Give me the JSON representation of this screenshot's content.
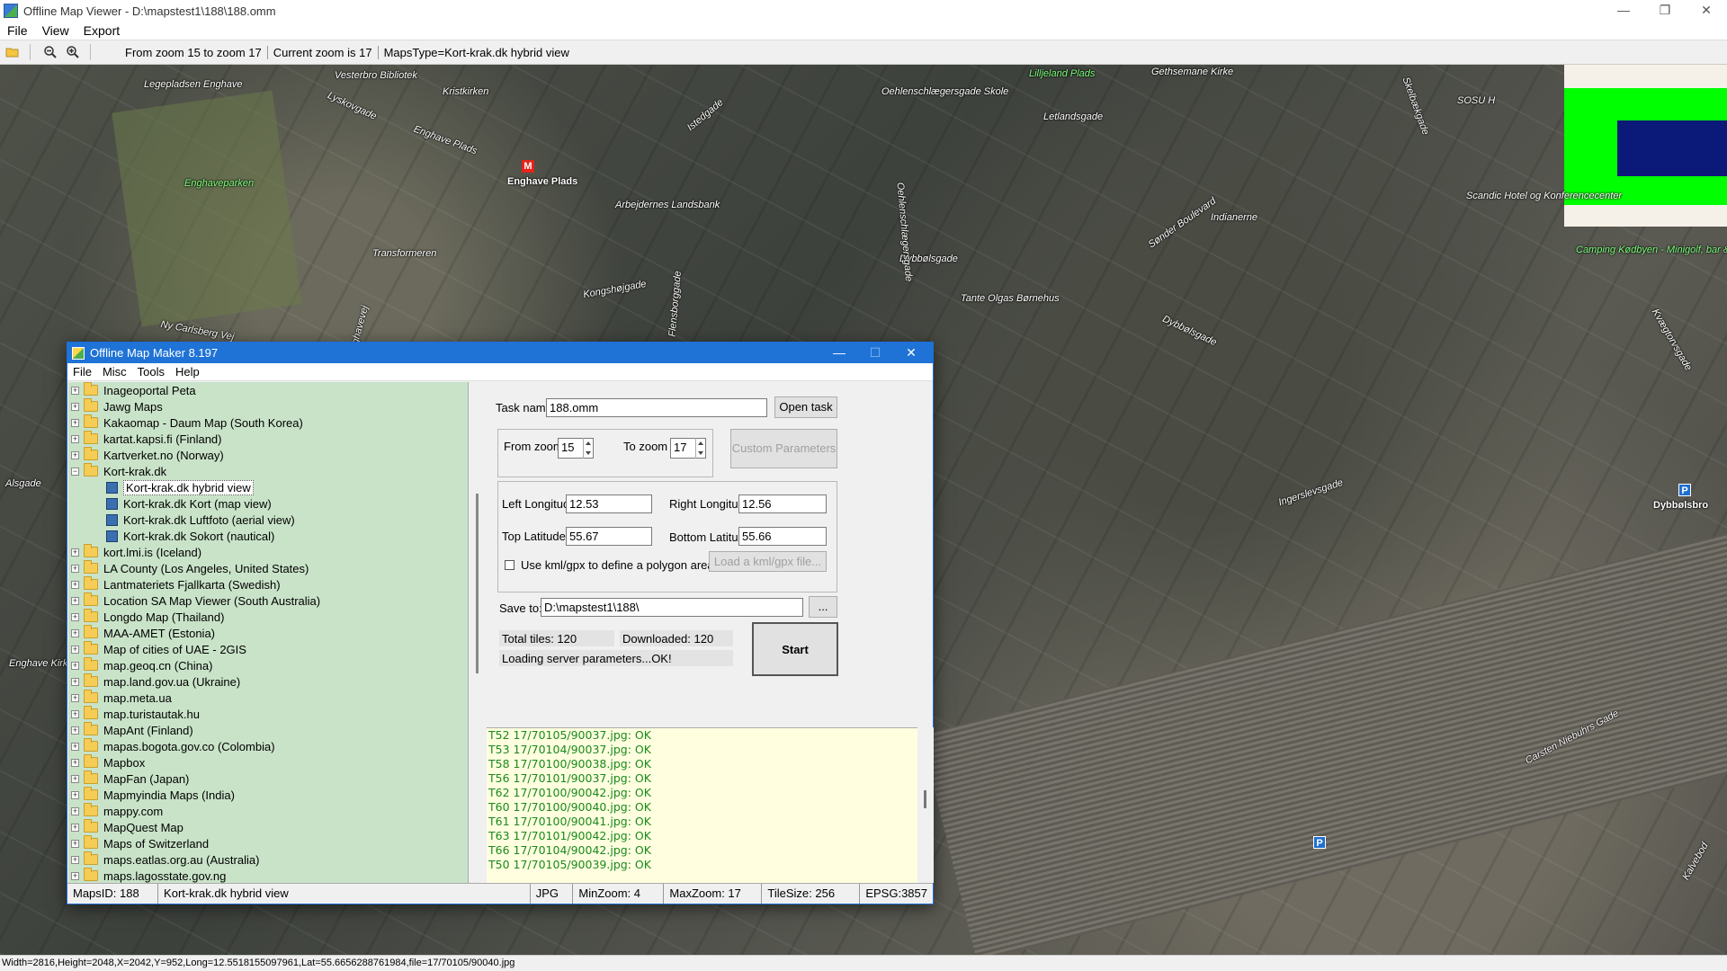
{
  "window": {
    "title": "Offline Map Viewer - D:\\mapstest1\\188\\188.omm",
    "controls": [
      "—",
      "❐",
      "✕"
    ]
  },
  "menu": [
    "File",
    "View",
    "Export"
  ],
  "toolbar": {
    "zoom_range": "From zoom 15 to zoom 17",
    "current_zoom": "Current zoom is 17",
    "maps_type": "MapsType=Kort-krak.dk hybrid view"
  },
  "map_labels": [
    "Vesterbro Bibliotek",
    "Legepladsen Enghave",
    "Lyskovgade",
    "Kristkirken",
    "Enghave Plads",
    "Enghaveparken",
    "Enghave Plads",
    "Istedgade",
    "Oehlenschlægersgade Skole",
    "Lilljeland Plads",
    "Gethsemane Kirke",
    "Letlandsgade",
    "Skelbækgade",
    "SOSU H",
    "Arbejdernes Landsbank",
    "Transformeren",
    "Kongshøjgade",
    "Dybbølsgade",
    "Sønder Boulevard",
    "Indianerne",
    "Tante Olgas Børnehus",
    "Scandic Hotel og Konferencecenter",
    "Camping Kødbyen - Minigolf, bar & burgers",
    "Ny Carlsberg Vej",
    "Enghavevej",
    "Dybbølsgade",
    "Ingerslevsgade",
    "Dybbølsbro",
    "Carsten Niebuhrs Gade",
    "Alsgade",
    "Enghave Kirke",
    "Oehlenschlægersgade",
    "Flensborggade",
    "Kvægtorvsgade",
    "Kalvebod"
  ],
  "map_symbols": {
    "metro": "M",
    "parking": "P"
  },
  "colors": {
    "dialog_title": "#1f73d6",
    "tree_bg": "#c9e3c9",
    "log_bg": "#ffffe0",
    "log_text": "#1a8a1a",
    "minimap_green": "#00ff00",
    "minimap_blue": "#0b1a78"
  },
  "statusline": "Width=2816,Height=2048,X=2042,Y=952,Long=12.5518155097961,Lat=55.6656288761984,file=17/70105/90040.jpg",
  "dialog": {
    "title": "Offline Map Maker 8.197",
    "controls": [
      "—",
      "☐",
      "✕"
    ],
    "menu": [
      "File",
      "Misc",
      "Tools",
      "Help"
    ],
    "tree": [
      {
        "label": "Inageoportal Peta",
        "type": "folder"
      },
      {
        "label": "Jawg Maps",
        "type": "folder"
      },
      {
        "label": "Kakaomap - Daum Map (South Korea)",
        "type": "folder"
      },
      {
        "label": "kartat.kapsi.fi (Finland)",
        "type": "folder"
      },
      {
        "label": "Kartverket.no (Norway)",
        "type": "folder"
      },
      {
        "label": "Kort-krak.dk",
        "type": "folder",
        "expanded": true
      },
      {
        "label": "Kort-krak.dk hybrid view",
        "type": "map",
        "selected": true
      },
      {
        "label": "Kort-krak.dk Kort (map view)",
        "type": "map"
      },
      {
        "label": "Kort-krak.dk Luftfoto (aerial view)",
        "type": "map"
      },
      {
        "label": "Kort-krak.dk Sokort (nautical)",
        "type": "map"
      },
      {
        "label": "kort.lmi.is (Iceland)",
        "type": "folder"
      },
      {
        "label": "LA County (Los Angeles, United States)",
        "type": "folder"
      },
      {
        "label": "Lantmateriets Fjallkarta (Swedish)",
        "type": "folder"
      },
      {
        "label": "Location SA Map Viewer (South Australia)",
        "type": "folder"
      },
      {
        "label": "Longdo Map (Thailand)",
        "type": "folder"
      },
      {
        "label": "MAA-AMET (Estonia)",
        "type": "folder"
      },
      {
        "label": "Map of cities of UAE - 2GIS",
        "type": "folder"
      },
      {
        "label": "map.geoq.cn (China)",
        "type": "folder"
      },
      {
        "label": "map.land.gov.ua (Ukraine)",
        "type": "folder"
      },
      {
        "label": "map.meta.ua",
        "type": "folder"
      },
      {
        "label": "map.turistautak.hu",
        "type": "folder"
      },
      {
        "label": "MapAnt (Finland)",
        "type": "folder"
      },
      {
        "label": "mapas.bogota.gov.co (Colombia)",
        "type": "folder"
      },
      {
        "label": "Mapbox",
        "type": "folder"
      },
      {
        "label": "MapFan (Japan)",
        "type": "folder"
      },
      {
        "label": "Mapmyindia Maps (India)",
        "type": "folder"
      },
      {
        "label": "mappy.com",
        "type": "folder"
      },
      {
        "label": "MapQuest Map",
        "type": "folder"
      },
      {
        "label": "Maps of Switzerland",
        "type": "folder"
      },
      {
        "label": "maps.eatlas.org.au (Australia)",
        "type": "folder"
      },
      {
        "label": "maps.lagosstate.gov.ng",
        "type": "folder"
      }
    ],
    "task_name_label": "Task name",
    "task_name_value": "188.omm",
    "open_task": "Open task ...",
    "from_zoom_label": "From zoom",
    "from_zoom_value": "15",
    "to_zoom_label": "To zoom",
    "to_zoom_value": "17",
    "custom_params": "Custom Parameters",
    "left_lon_label": "Left Longitude",
    "left_lon_value": "12.53",
    "right_lon_label": "Right Longitude",
    "right_lon_value": "12.56",
    "top_lat_label": "Top Latitude",
    "top_lat_value": "55.67",
    "bottom_lat_label": "Bottom Latitude",
    "bottom_lat_value": "55.66",
    "kml_label": "Use kml/gpx to define a polygon area",
    "kml_button": "Load a kml/gpx file...",
    "save_to_label": "Save to:",
    "save_to_value": "D:\\mapstest1\\188\\",
    "browse": "...",
    "total_tiles": "Total tiles: 120",
    "downloaded": "Downloaded: 120",
    "server_status": "Loading server parameters...OK!",
    "start": "Start",
    "log": [
      "T52 17/70105/90037.jpg: OK",
      "T53 17/70104/90037.jpg: OK",
      "T58 17/70100/90038.jpg: OK",
      "T56 17/70101/90037.jpg: OK",
      "T62 17/70100/90042.jpg: OK",
      "T60 17/70100/90040.jpg: OK",
      "T61 17/70100/90041.jpg: OK",
      "T63 17/70101/90042.jpg: OK",
      "T66 17/70104/90042.jpg: OK",
      "T50 17/70105/90039.jpg: OK"
    ],
    "status": {
      "maps_id": "MapsID: 188",
      "map_name": "Kort-krak.dk hybrid view",
      "format": "JPG",
      "min_zoom": "MinZoom: 4",
      "max_zoom": "MaxZoom: 17",
      "tile_size": "TileSize: 256",
      "epsg": "EPSG:3857"
    }
  }
}
